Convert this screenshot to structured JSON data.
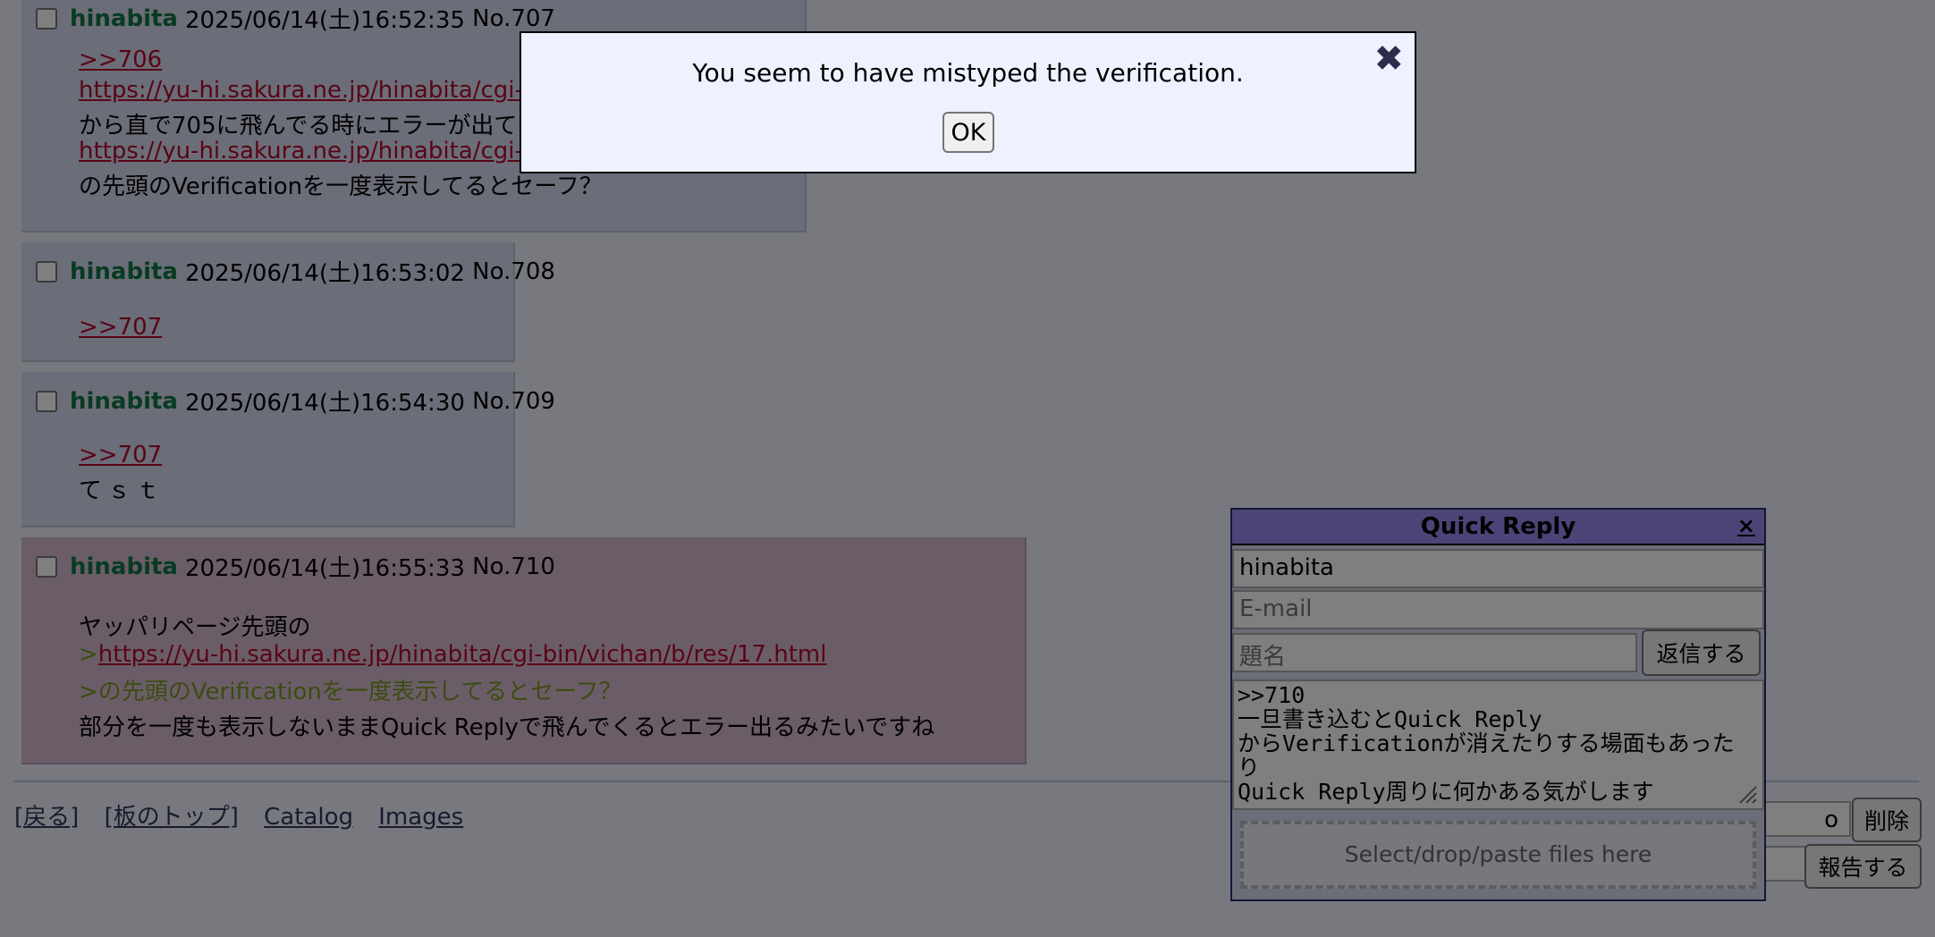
{
  "posts": [
    {
      "name": "hinabita",
      "datetime": "2025/06/14(土)16:52:35",
      "number": "No.707",
      "lines": [
        {
          "type": "link",
          "text": ">>706"
        },
        {
          "type": "link",
          "text": "https://yu-hi.sakura.ne.jp/hinabita/cgi-bin/v"
        },
        {
          "type": "text",
          "text": "から直で705に飛んでる時にエラーが出て"
        },
        {
          "type": "link",
          "text": "https://yu-hi.sakura.ne.jp/hinabita/cgi-bin/v"
        },
        {
          "type": "text",
          "text": "の先頭のVerificationを一度表示してるとセーフ？"
        }
      ]
    },
    {
      "name": "hinabita",
      "datetime": "2025/06/14(土)16:53:02",
      "number": "No.708",
      "lines": [
        {
          "type": "link",
          "text": ">>707"
        }
      ]
    },
    {
      "name": "hinabita",
      "datetime": "2025/06/14(土)16:54:30",
      "number": "No.709",
      "lines": [
        {
          "type": "link",
          "text": ">>707"
        },
        {
          "type": "text",
          "text": "てｓｔ"
        }
      ]
    },
    {
      "name": "hinabita",
      "datetime": "2025/06/14(土)16:55:33",
      "number": "No.710",
      "lines": [
        {
          "type": "text",
          "text": "ヤッパリページ先頭の"
        },
        {
          "type": "quote-link",
          "prefix": ">",
          "text": "https://yu-hi.sakura.ne.jp/hinabita/cgi-bin/vichan/b/res/17.html"
        },
        {
          "type": "quote",
          "text": ">の先頭のVerificationを一度表示してるとセーフ？"
        },
        {
          "type": "text",
          "text": "部分を一度も表示しないままQuick Replyで飛んでくるとエラー出るみたいですね"
        }
      ]
    }
  ],
  "footer": {
    "links": [
      "[戻る]",
      "[板のトップ]",
      "Catalog",
      "Images"
    ],
    "delete_button": "削除",
    "report_button": "報告する",
    "password_partial": "o"
  },
  "quick_reply": {
    "title": "Quick Reply",
    "close": "×",
    "name_value": "hinabita",
    "email_placeholder": "E-mail",
    "subject_placeholder": "題名",
    "submit_label": "返信する",
    "body_value": ">>710\n一旦書き込むとQuick Reply\nからVerificationが消えたりする場面もあった\nり\nQuick Reply周りに何かある気がします",
    "dropzone_text": "Select/drop/paste files here"
  },
  "alert": {
    "message": "You seem to have mistyped the verification.",
    "ok_label": "OK",
    "close": "✖"
  }
}
